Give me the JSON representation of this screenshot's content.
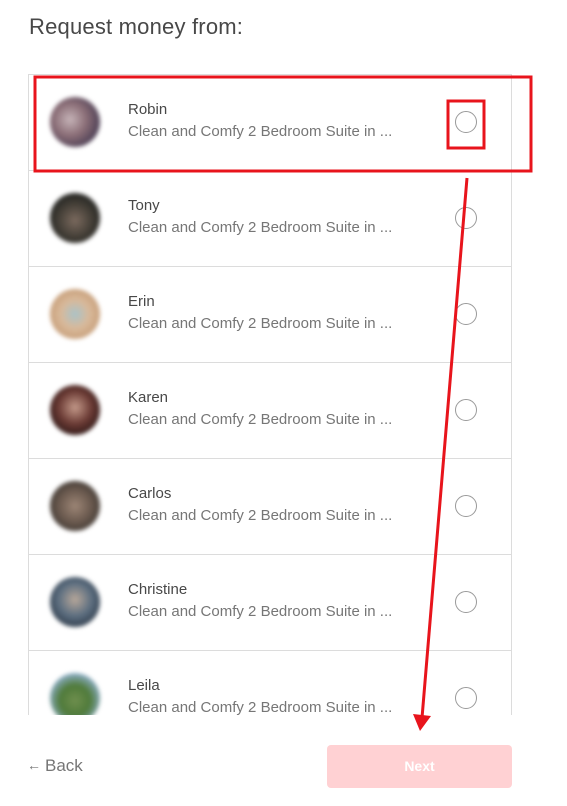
{
  "title": "Request money from:",
  "guests": [
    {
      "name": "Robin",
      "listing": "Clean and Comfy 2 Bedroom Suite in ...",
      "selected": false
    },
    {
      "name": "Tony",
      "listing": "Clean and Comfy 2 Bedroom Suite in ...",
      "selected": false
    },
    {
      "name": "Erin",
      "listing": "Clean and Comfy 2 Bedroom Suite in ...",
      "selected": false
    },
    {
      "name": "Karen",
      "listing": "Clean and Comfy 2 Bedroom Suite in ...",
      "selected": false
    },
    {
      "name": "Carlos",
      "listing": "Clean and Comfy 2 Bedroom Suite in ...",
      "selected": false
    },
    {
      "name": "Christine",
      "listing": "Clean and Comfy 2 Bedroom Suite in ...",
      "selected": false
    },
    {
      "name": "Leila",
      "listing": "Clean and Comfy 2 Bedroom Suite in ...",
      "selected": false
    }
  ],
  "footer": {
    "back_label": "Back",
    "back_icon": "arrow-left-icon",
    "next_label": "Next"
  },
  "colors": {
    "next_button_disabled": "#ffd1d3",
    "annotation": "#e8141c",
    "divider": "#dcdcdc"
  }
}
